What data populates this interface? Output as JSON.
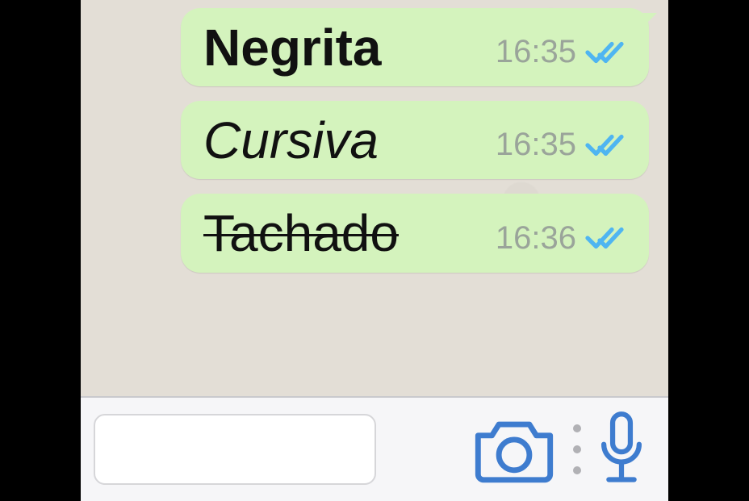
{
  "messages": [
    {
      "text": "Negrita",
      "style": "bold",
      "time": "16:35",
      "read": true
    },
    {
      "text": "Cursiva",
      "style": "italic",
      "time": "16:35",
      "read": true
    },
    {
      "text": "Tachado",
      "style": "strike",
      "time": "16:36",
      "read": true
    }
  ],
  "icons": {
    "camera": "camera-icon",
    "more": "more-icon",
    "mic": "mic-icon",
    "read_ticks": "read-ticks-icon"
  },
  "colors": {
    "bubble": "#d4f3bd",
    "tick": "#4fb5f1",
    "toolbar_icon": "#3e7ccf"
  }
}
